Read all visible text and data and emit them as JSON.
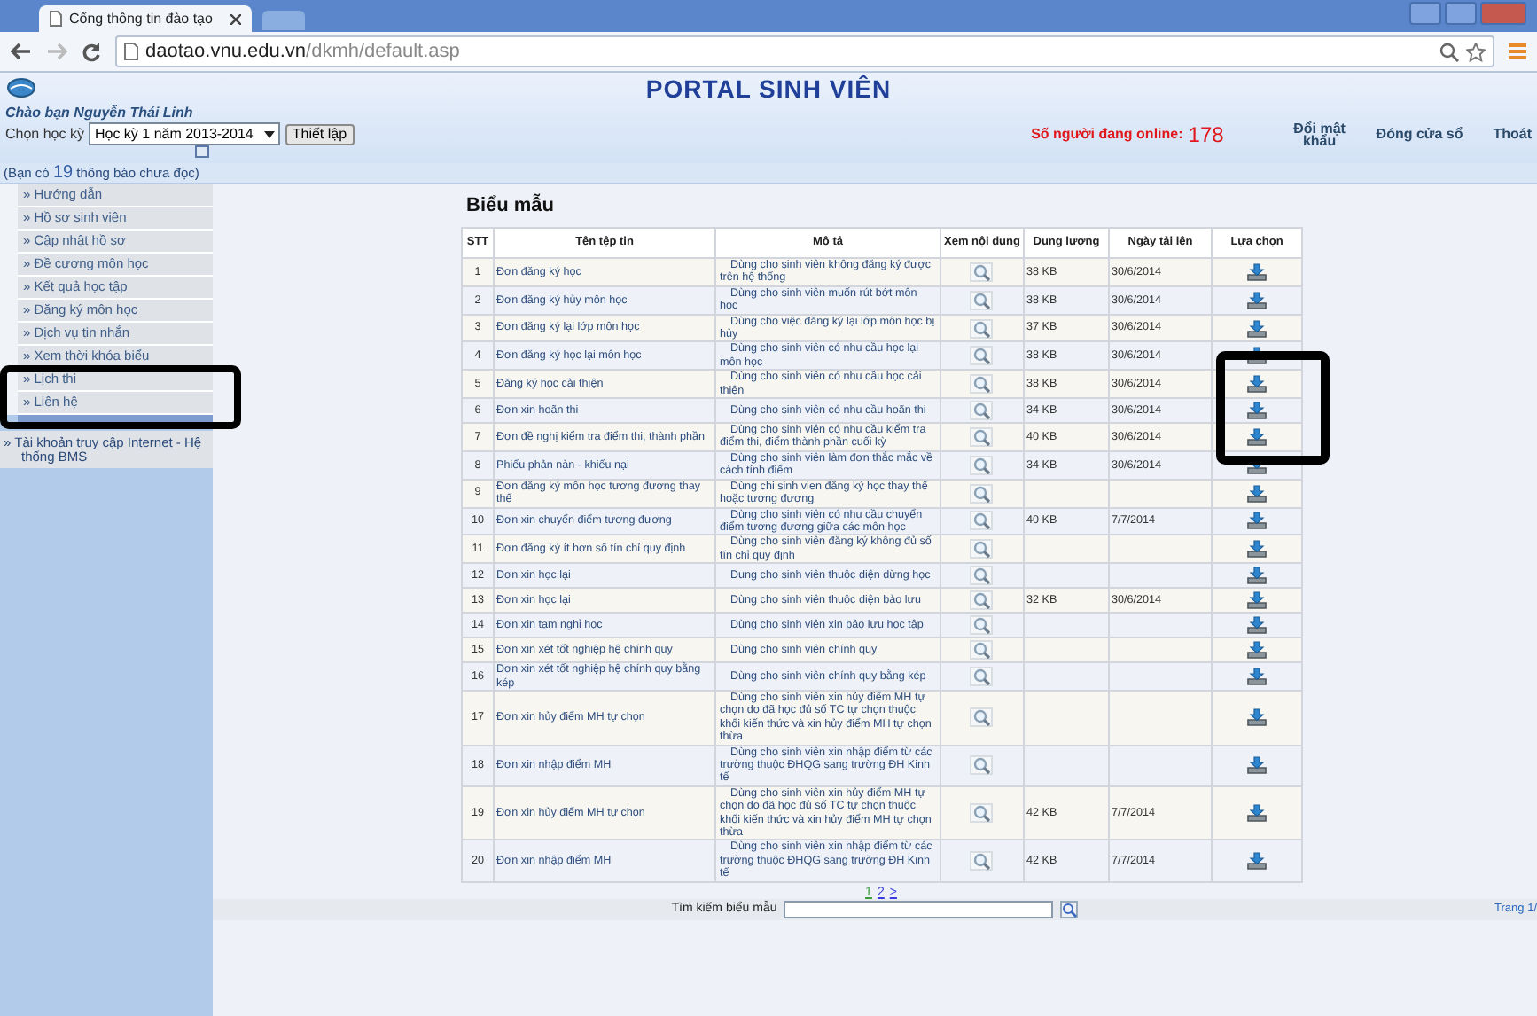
{
  "browser": {
    "tab_title": "Cổng thông tin đào tạo",
    "url_host": "daotao.vnu.edu.vn",
    "url_path": "/dkmh/default.asp"
  },
  "header": {
    "title": "PORTAL SINH VIÊN",
    "greeting": "Chào bạn Nguyễn Thái Linh",
    "semester_label": "Chọn học kỳ",
    "semester_value": "Học kỳ 1 năm 2013-2014",
    "apply_button": "Thiết lập",
    "online_label": "Số người đang online:",
    "online_count": "178",
    "links": [
      "Đổi mật khẩu",
      "Đóng cửa sổ",
      "Thoát"
    ]
  },
  "notification": {
    "prefix": "(Bạn có",
    "count": "19",
    "suffix": "thông báo chưa đọc)"
  },
  "sidebar": {
    "items": [
      "» Hướng dẫn",
      "» Hồ sơ sinh viên",
      "» Cập nhật hồ sơ",
      "» Đề cương môn học",
      "» Kết quả học tập",
      "» Đăng ký môn học",
      "» Dịch vụ tin nhắn",
      "» Xem thời khóa biểu",
      "» Lịch thi",
      "» Liên hệ"
    ],
    "account_link": "» Tài khoản truy cập Internet - Hệ thống BMS"
  },
  "page": {
    "heading": "Biểu mẫu",
    "table": {
      "columns": [
        "STT",
        "Tên tệp tin",
        "Mô tả",
        "Xem nội dung",
        "Dung lượng",
        "Ngày tải lên",
        "Lựa chọn"
      ],
      "rows": [
        {
          "stt": "1",
          "name": "Đơn đăng ký học",
          "description": "Dùng cho sinh viên không đăng ký được trên hệ thống",
          "size": "38 KB",
          "date": "30/6/2014"
        },
        {
          "stt": "2",
          "name": "Đơn đăng ký hủy môn học",
          "description": "Dùng cho sinh viên muốn rút bớt môn học",
          "size": "38 KB",
          "date": "30/6/2014"
        },
        {
          "stt": "3",
          "name": "Đơn đăng ký lại lớp môn học",
          "description": "Dùng cho việc đăng ký lại lớp môn học bị hủy",
          "size": "37 KB",
          "date": "30/6/2014"
        },
        {
          "stt": "4",
          "name": "Đơn đăng ký học lại môn học",
          "description": "Dùng cho sinh viên có nhu cầu học lại môn học",
          "size": "38 KB",
          "date": "30/6/2014"
        },
        {
          "stt": "5",
          "name": "Đăng ký học cải thiện",
          "description": "Dùng cho sinh viên có nhu cầu học cải thiện",
          "size": "38 KB",
          "date": "30/6/2014"
        },
        {
          "stt": "6",
          "name": "Đơn xin hoãn thi",
          "description": "Dùng cho sinh viên có nhu cầu hoãn thi",
          "size": "34 KB",
          "date": "30/6/2014"
        },
        {
          "stt": "7",
          "name": "Đơn đề nghị kiểm tra điểm thi, thành phần",
          "description": "Dùng cho sinh viên có nhu cầu kiểm tra điểm thi, điểm thành phần cuối kỳ",
          "size": "40 KB",
          "date": "30/6/2014"
        },
        {
          "stt": "8",
          "name": "Phiếu phản nàn - khiếu nại",
          "description": "Dùng cho sinh viên làm đơn thắc mắc về cách tính điểm",
          "size": "34 KB",
          "date": "30/6/2014"
        },
        {
          "stt": "9",
          "name": "Đơn đăng ký môn học tương đương thay thế",
          "description": "Dùng chi sinh vien đăng ký học thay thế hoặc tương đương"
        },
        {
          "stt": "10",
          "name": "Đơn xin chuyển điểm tương đương",
          "description": "Dùng cho sinh viên có nhu cầu chuyển điểm tương đương giữa các môn học",
          "size": "40 KB",
          "date": "7/7/2014"
        },
        {
          "stt": "11",
          "name": "Đơn đăng ký ít hơn số tín chỉ quy định",
          "description": "Dùng cho sinh viên đăng ký không đủ số tín chỉ quy định"
        },
        {
          "stt": "12",
          "name": "Đơn xin học lại",
          "description": "Dung cho sinh viên thuộc diện dừng học"
        },
        {
          "stt": "13",
          "name": "Đơn xin học lại",
          "description": "Dùng cho sinh viên thuộc diện bảo lưu",
          "size": "32 KB",
          "date": "30/6/2014"
        },
        {
          "stt": "14",
          "name": "Đơn xin tạm nghỉ học",
          "description": "Dùng cho sinh viên xin bảo lưu học tập"
        },
        {
          "stt": "15",
          "name": "Đơn xin xét tốt nghiệp hệ chính quy",
          "description": "Dùng cho sinh viên chính quy"
        },
        {
          "stt": "16",
          "name": "Đơn xin xét tốt nghiệp hệ chính quy bằng kép",
          "description": "Dùng cho sinh viên chính quy bằng kép"
        },
        {
          "stt": "17",
          "name": "Đơn xin hủy điểm MH tự chọn",
          "description": "Dùng cho sinh viên xin hủy điểm MH tự chọn do đã học đủ số TC tự chọn thuộc khối kiến thức và xin hủy điểm MH tự chọn thừa"
        },
        {
          "stt": "18",
          "name": "Đơn xin nhập điểm MH",
          "description": "Dùng cho sinh viên xin nhập điểm từ các trường thuộc ĐHQG sang trường ĐH Kinh tế"
        },
        {
          "stt": "19",
          "name": "Đơn xin hủy điểm MH tự chọn",
          "description": "Dùng cho sinh viên xin hủy điểm MH tự chọn do đã học đủ số TC tự chọn thuộc khối kiến thức và xin hủy điểm MH tự chọn thừa",
          "size": "42 KB",
          "date": "7/7/2014"
        },
        {
          "stt": "20",
          "name": "Đơn xin nhập điểm MH",
          "description": "Dùng cho sinh viên xin nhập điểm từ các trường thuộc ĐHQG sang trường ĐH Kinh tế",
          "size": "42 KB",
          "date": "7/7/2014"
        }
      ]
    },
    "pagination": [
      {
        "label": "1",
        "selected": true
      },
      {
        "label": "2",
        "selected": false
      },
      {
        "label": ">",
        "selected": false
      }
    ],
    "search_label": "Tìm kiếm biểu mẫu",
    "page_info": "Trang 1/"
  }
}
